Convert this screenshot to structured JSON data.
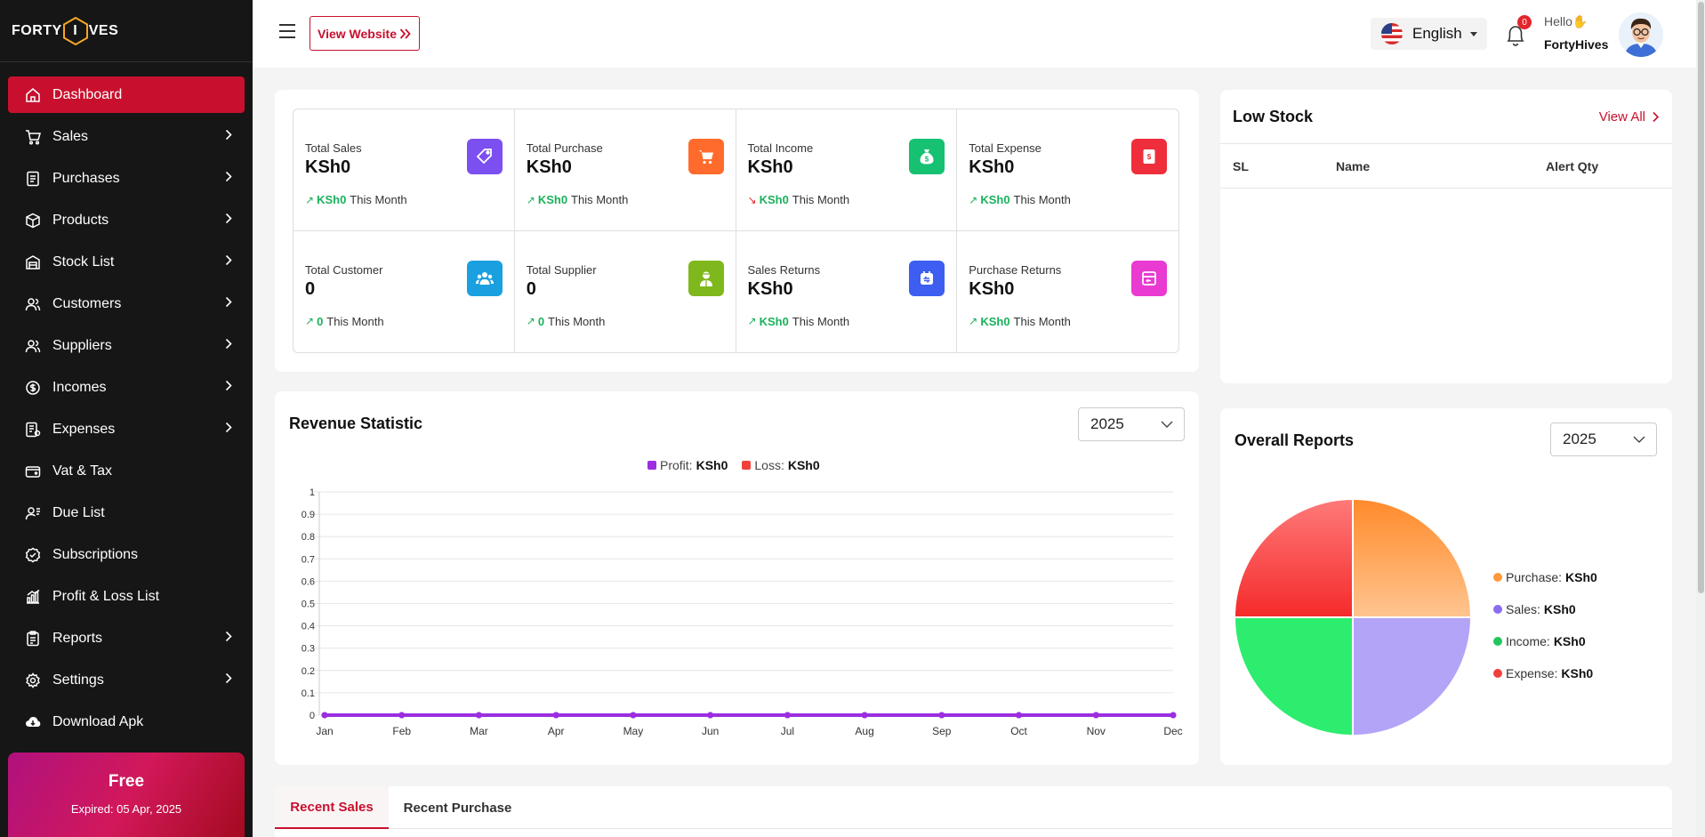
{
  "sidebar": {
    "logo_left": "FORTY",
    "logo_mid": "I",
    "logo_right": "VES",
    "items": [
      {
        "label": "Dashboard"
      },
      {
        "label": "Sales"
      },
      {
        "label": "Purchases"
      },
      {
        "label": "Products"
      },
      {
        "label": "Stock List"
      },
      {
        "label": "Customers"
      },
      {
        "label": "Suppliers"
      },
      {
        "label": "Incomes"
      },
      {
        "label": "Expenses"
      },
      {
        "label": "Vat & Tax"
      },
      {
        "label": "Due List"
      },
      {
        "label": "Subscriptions"
      },
      {
        "label": "Profit & Loss List"
      },
      {
        "label": "Reports"
      },
      {
        "label": "Settings"
      },
      {
        "label": "Download Apk"
      }
    ],
    "plan": {
      "title": "Free",
      "expiry": "Expired: 05 Apr, 2025"
    }
  },
  "topbar": {
    "view_website": "View Website",
    "language": "English",
    "notification_count": "0",
    "hello": "Hello",
    "user_name": "FortyHives"
  },
  "stats": [
    {
      "label": "Total Sales",
      "value": "KSh0",
      "month_value": "KSh0",
      "month_label": "This Month",
      "trend": "up",
      "icon": "tag-icon",
      "color": "#7b4ff0"
    },
    {
      "label": "Total Purchase",
      "value": "KSh0",
      "month_value": "KSh0",
      "month_label": "This Month",
      "trend": "up",
      "icon": "cart-icon",
      "color": "#ff6b2c"
    },
    {
      "label": "Total Income",
      "value": "KSh0",
      "month_value": "KSh0",
      "month_label": "This Month",
      "trend": "down",
      "icon": "money-bag-icon",
      "color": "#16c172"
    },
    {
      "label": "Total Expense",
      "value": "KSh0",
      "month_value": "KSh0",
      "month_label": "This Month",
      "trend": "up",
      "icon": "expense-icon",
      "color": "#ef2e3c"
    },
    {
      "label": "Total Customer",
      "value": "0",
      "month_value": "0",
      "month_label": "This Month",
      "trend": "up",
      "icon": "users-icon",
      "color": "#1aa0e0"
    },
    {
      "label": "Total Supplier",
      "value": "0",
      "month_value": "0",
      "month_label": "This Month",
      "trend": "up",
      "icon": "supplier-icon",
      "color": "#7fb81c"
    },
    {
      "label": "Sales Returns",
      "value": "KSh0",
      "month_value": "KSh0",
      "month_label": "This Month",
      "trend": "up",
      "icon": "sales-return-icon",
      "color": "#3d5ef0"
    },
    {
      "label": "Purchase Returns",
      "value": "KSh0",
      "month_value": "KSh0",
      "month_label": "This Month",
      "trend": "up",
      "icon": "purchase-return-icon",
      "color": "#e93ad2"
    }
  ],
  "low_stock": {
    "title": "Low Stock",
    "view_all": "View All",
    "columns": [
      "SL",
      "Name",
      "Alert Qty"
    ]
  },
  "revenue": {
    "title": "Revenue Statistic",
    "year": "2025",
    "legend": [
      {
        "name": "Profit:",
        "value": "KSh0",
        "color": "#9b2ee0"
      },
      {
        "name": "Loss:",
        "value": "KSh0",
        "color": "#f0403a"
      }
    ]
  },
  "overall": {
    "title": "Overall Reports",
    "year": "2025",
    "legend": [
      {
        "name": "Purchase:",
        "value": "KSh0",
        "color": "#ff9a3a"
      },
      {
        "name": "Sales:",
        "value": "KSh0",
        "color": "#8a6cf0"
      },
      {
        "name": "Income:",
        "value": "KSh0",
        "color": "#22c55e"
      },
      {
        "name": "Expense:",
        "value": "KSh0",
        "color": "#f0403a"
      }
    ]
  },
  "tabs": [
    {
      "label": "Recent Sales"
    },
    {
      "label": "Recent Purchase"
    }
  ],
  "chart_data": [
    {
      "type": "line",
      "categories": [
        "Jan",
        "Feb",
        "Mar",
        "Apr",
        "May",
        "Jun",
        "Jul",
        "Aug",
        "Sep",
        "Oct",
        "Nov",
        "Dec"
      ],
      "yticks": [
        "0",
        "0.1",
        "0.2",
        "0.3",
        "0.4",
        "0.5",
        "0.6",
        "0.7",
        "0.8",
        "0.9",
        "1"
      ],
      "ylim": [
        0,
        1
      ],
      "grid": true,
      "series": [
        {
          "name": "Profit",
          "values": [
            0,
            0,
            0,
            0,
            0,
            0,
            0,
            0,
            0,
            0,
            0,
            0
          ],
          "color": "#9b2ee0"
        },
        {
          "name": "Loss",
          "values": [
            0,
            0,
            0,
            0,
            0,
            0,
            0,
            0,
            0,
            0,
            0,
            0
          ],
          "color": "#f0403a"
        }
      ],
      "legend": "top-center"
    },
    {
      "type": "pie",
      "categories": [
        "Purchase",
        "Sales",
        "Income",
        "Expense"
      ],
      "values": [
        1,
        1,
        1,
        1
      ],
      "colors": [
        "#ff9a3a",
        "#b3a4f8",
        "#2ded6f",
        "#f53b3b"
      ],
      "legend": "right"
    }
  ]
}
